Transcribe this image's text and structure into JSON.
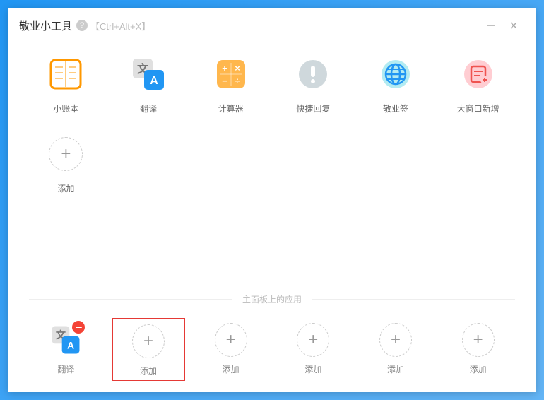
{
  "window": {
    "title": "敬业小工具",
    "shortcut": "【Ctrl+Alt+X】"
  },
  "tools": [
    {
      "id": "ledger",
      "label": "小账本",
      "icon": "ledger-icon"
    },
    {
      "id": "translate",
      "label": "翻译",
      "icon": "translate-icon"
    },
    {
      "id": "calculator",
      "label": "计算器",
      "icon": "calculator-icon"
    },
    {
      "id": "quickreply",
      "label": "快捷回复",
      "icon": "quickreply-icon"
    },
    {
      "id": "jingye",
      "label": "敬业签",
      "icon": "globe-icon"
    },
    {
      "id": "bigwindow",
      "label": "大窗口新增",
      "icon": "newwindow-icon"
    },
    {
      "id": "add",
      "label": "添加",
      "icon": "add"
    }
  ],
  "divider": {
    "label": "主面板上的应用"
  },
  "panel": [
    {
      "id": "translate",
      "label": "翻译",
      "icon": "translate-icon",
      "removable": true,
      "highlighted": false
    },
    {
      "id": "add1",
      "label": "添加",
      "icon": "add",
      "highlighted": true
    },
    {
      "id": "add2",
      "label": "添加",
      "icon": "add",
      "highlighted": false
    },
    {
      "id": "add3",
      "label": "添加",
      "icon": "add",
      "highlighted": false
    },
    {
      "id": "add4",
      "label": "添加",
      "icon": "add",
      "highlighted": false
    },
    {
      "id": "add5",
      "label": "添加",
      "icon": "add",
      "highlighted": false
    }
  ],
  "colors": {
    "highlight": "#e53935",
    "orange": "#ff9800",
    "blue": "#2196f3",
    "green": "#26c281",
    "pink": "#ffcdd2",
    "red": "#f44336",
    "grey": "#bdbdbd"
  }
}
